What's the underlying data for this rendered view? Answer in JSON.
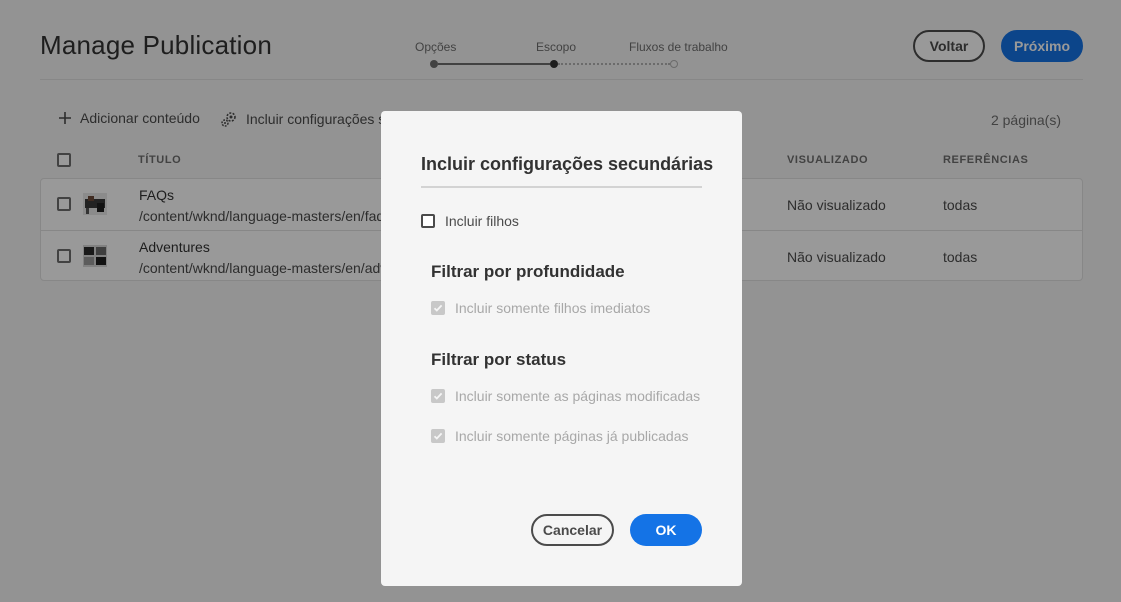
{
  "header": {
    "title": "Manage Publication",
    "back_label": "Voltar",
    "next_label": "Próximo"
  },
  "stepper": {
    "steps": [
      {
        "label": "Opções",
        "state": "done"
      },
      {
        "label": "Escopo",
        "state": "current"
      },
      {
        "label": "Fluxos de trabalho",
        "state": "future"
      }
    ]
  },
  "toolbar": {
    "add_content_label": "Adicionar conteúdo",
    "include_children_label": "Incluir configurações sec",
    "page_count": "2 página(s)"
  },
  "table": {
    "columns": {
      "title": "TÍTULO",
      "viewed": "VISUALIZADO",
      "references": "REFERÊNCIAS"
    },
    "rows": [
      {
        "title": "FAQs",
        "path": "/content/wknd/language-masters/en/faqs",
        "viewed": "Não visualizado",
        "references": "todas"
      },
      {
        "title": "Adventures",
        "path": "/content/wknd/language-masters/en/adventures",
        "viewed": "Não visualizado",
        "references": "todas"
      }
    ]
  },
  "dialog": {
    "title": "Incluir configurações secundárias",
    "include_children": {
      "label": "Incluir filhos",
      "checked": false
    },
    "depth_section": "Filtrar por profundidade",
    "immediate_children": {
      "label": "Incluir somente filhos imediatos",
      "checked": true,
      "disabled": true
    },
    "status_section": "Filtrar por status",
    "modified_only": {
      "label": "Incluir somente as páginas modificadas",
      "checked": true,
      "disabled": true
    },
    "published_only": {
      "label": "Incluir somente páginas já publicadas",
      "checked": true,
      "disabled": true
    },
    "cancel_label": "Cancelar",
    "ok_label": "OK"
  },
  "colors": {
    "accent": "#1473e6",
    "overlay": "rgba(0,0,0,0.4)"
  }
}
